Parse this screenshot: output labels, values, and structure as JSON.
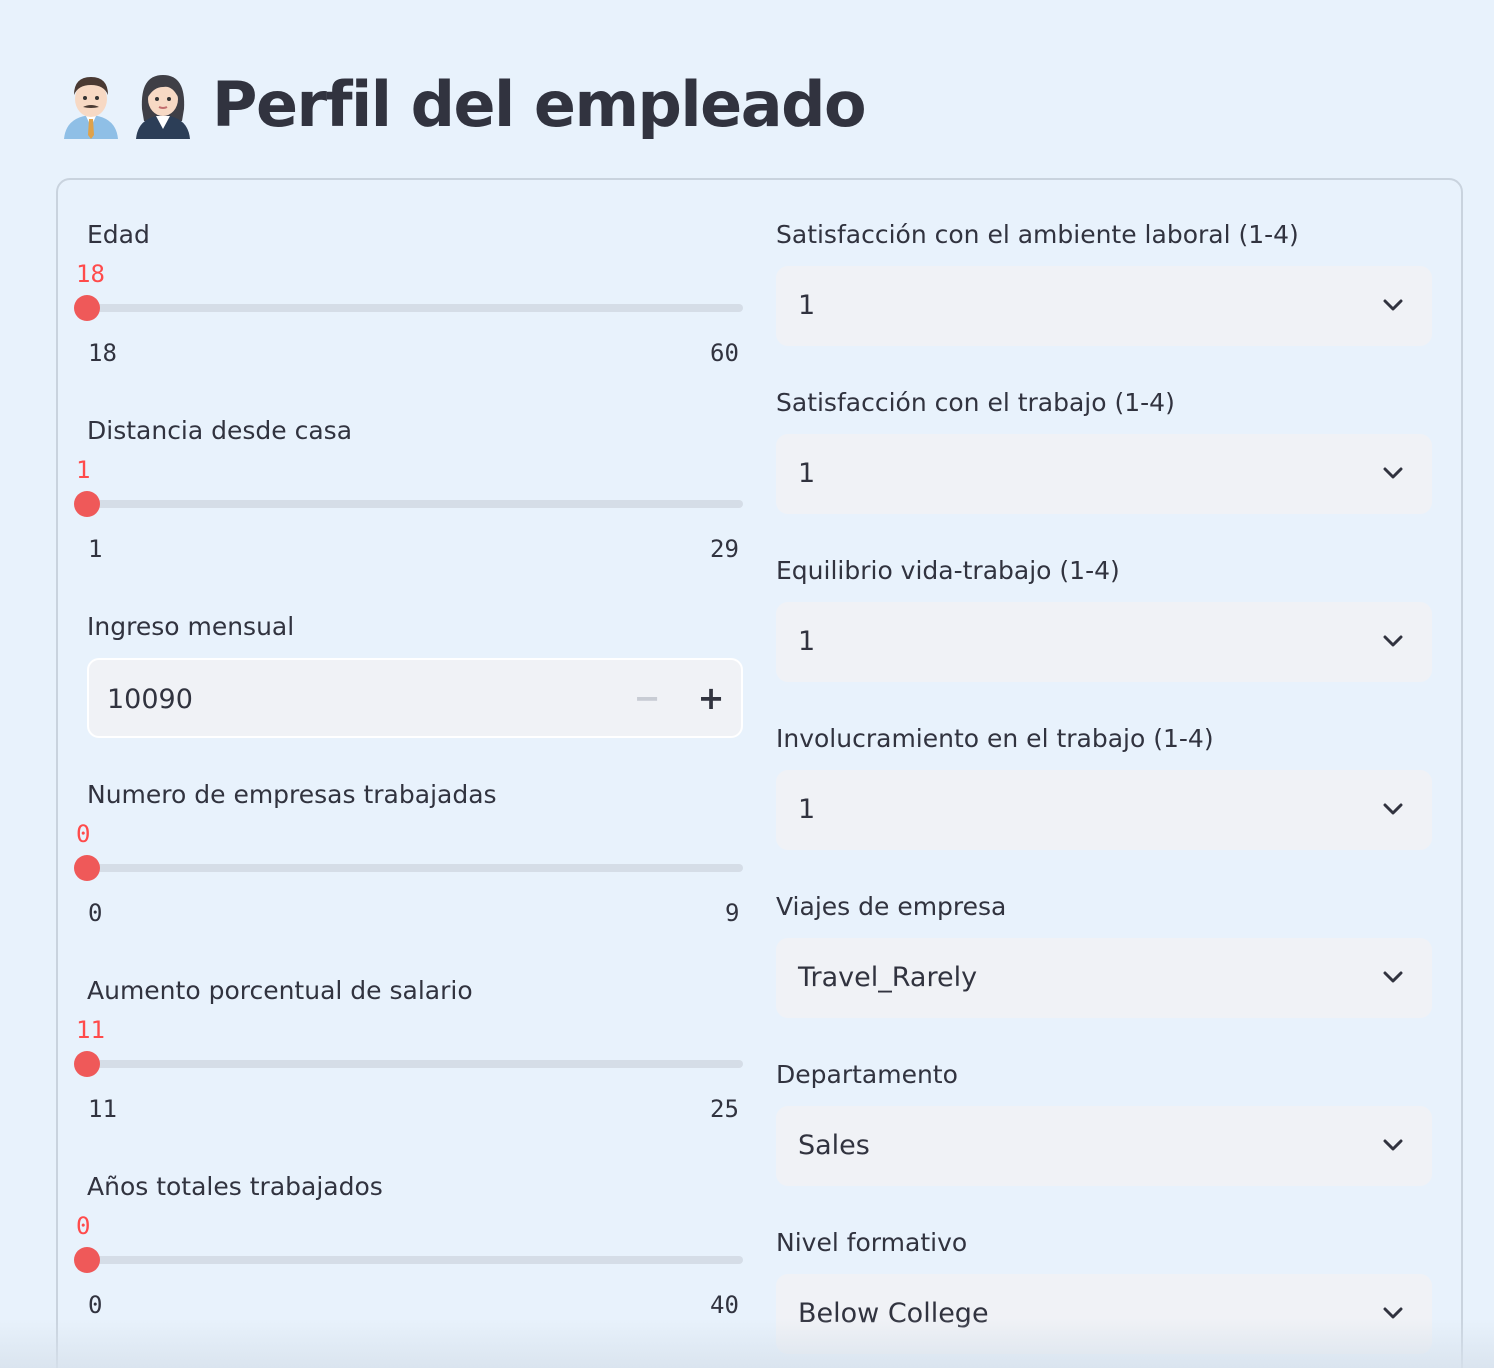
{
  "header": {
    "title": "Perfil del empleado",
    "icons": [
      "man-office-worker-icon",
      "woman-office-worker-icon"
    ]
  },
  "colors": {
    "background": "#e8f2fc",
    "accent": "#ff4b4b",
    "track": "#d5dde7",
    "input_bg": "#f0f2f6",
    "text": "#31333f"
  },
  "left_column": {
    "edad": {
      "label": "Edad",
      "value": "18",
      "min": "18",
      "max": "60",
      "fraction": 0
    },
    "distancia": {
      "label": "Distancia desde casa",
      "value": "1",
      "min": "1",
      "max": "29",
      "fraction": 0
    },
    "ingreso": {
      "label": "Ingreso mensual",
      "value": "10090",
      "minus": "−",
      "plus": "+"
    },
    "empresas": {
      "label": "Numero de empresas trabajadas",
      "value": "0",
      "min": "0",
      "max": "9",
      "fraction": 0
    },
    "aumento": {
      "label": "Aumento porcentual de salario",
      "value": "11",
      "min": "11",
      "max": "25",
      "fraction": 0
    },
    "anios": {
      "label": "Años totales trabajados",
      "value": "0",
      "min": "0",
      "max": "40",
      "fraction": 0
    }
  },
  "right_column": {
    "ambiente": {
      "label": "Satisfacción con el ambiente laboral (1-4)",
      "value": "1"
    },
    "trabajo": {
      "label": "Satisfacción con el trabajo (1-4)",
      "value": "1"
    },
    "equilibrio": {
      "label": "Equilibrio vida-trabajo (1-4)",
      "value": "1"
    },
    "involucramiento": {
      "label": "Involucramiento en el trabajo (1-4)",
      "value": "1"
    },
    "viajes": {
      "label": "Viajes de empresa",
      "value": "Travel_Rarely"
    },
    "departamento": {
      "label": "Departamento",
      "value": "Sales"
    },
    "nivel": {
      "label": "Nivel formativo",
      "value": "Below College"
    }
  }
}
